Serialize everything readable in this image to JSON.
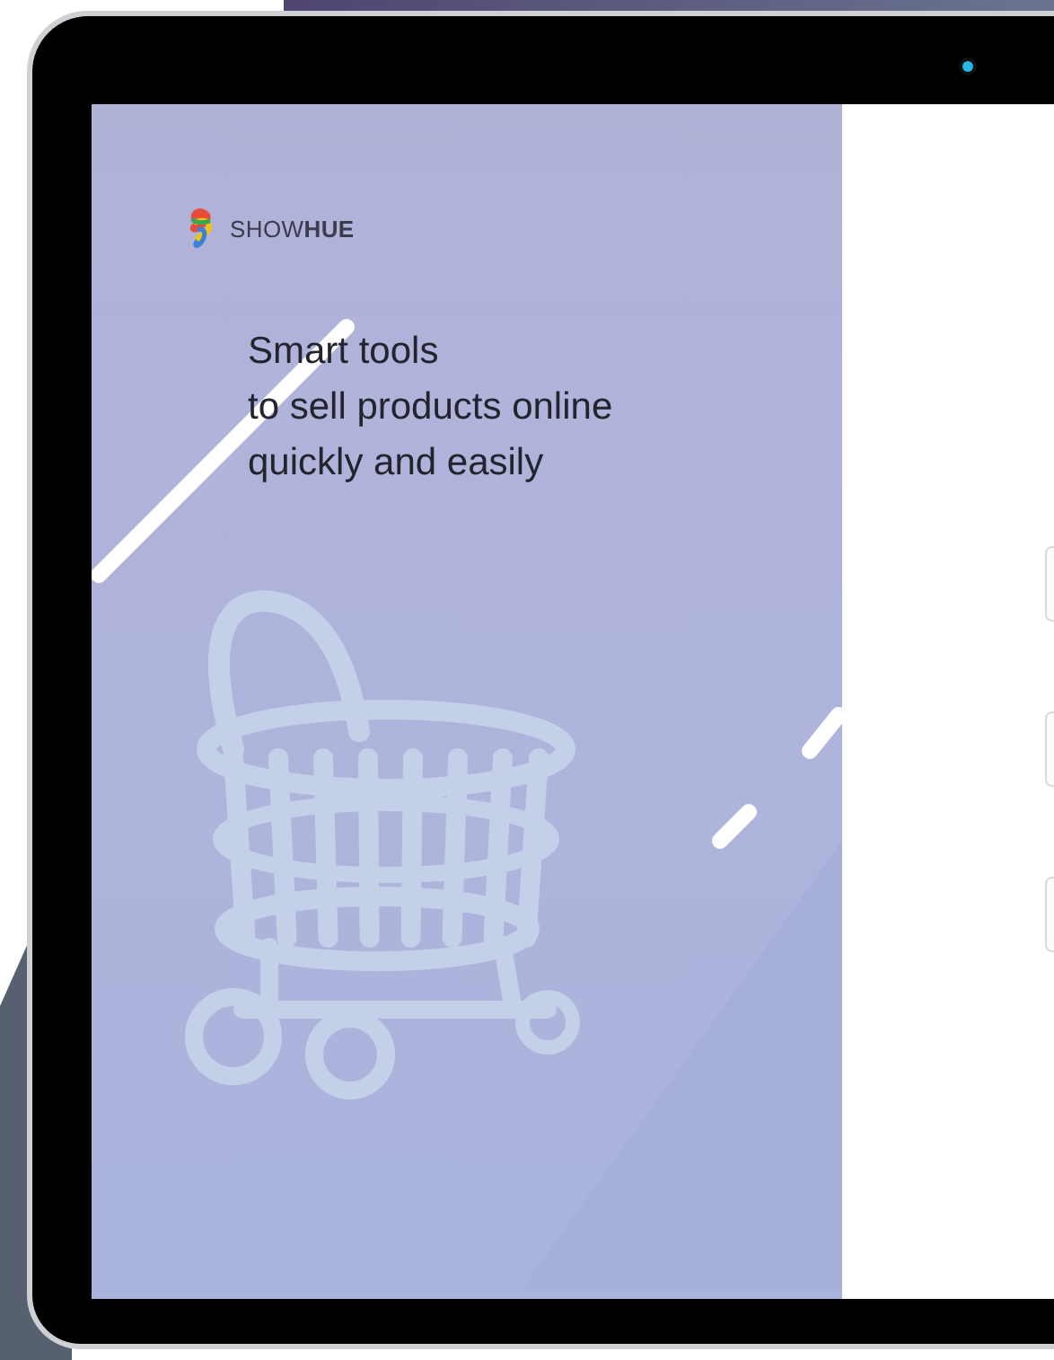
{
  "brand": {
    "name": "SHOW**HUE**"
  },
  "headline": "Smart tools\nto sell products online\nquickly and easily",
  "form_fields": [
    {
      "kind": "field"
    },
    {
      "kind": "field"
    },
    {
      "kind": "field"
    }
  ]
}
